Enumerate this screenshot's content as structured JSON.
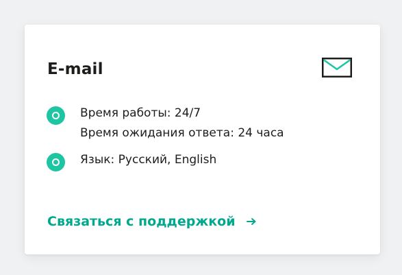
{
  "card": {
    "title": "E-mail",
    "icon": "mail-envelope-icon",
    "features": [
      {
        "lines": [
          "Время работы: 24/7",
          "Время ожидания ответа: 24 часа"
        ]
      },
      {
        "lines": [
          "Язык: Русский, English"
        ]
      }
    ],
    "cta_label": "Связаться с поддержкой",
    "cta_icon": "arrow-right-icon"
  },
  "colors": {
    "accent": "#1dc5a3",
    "link": "#00a88e",
    "text": "#1d1d1b",
    "page_background": "#eff1f2",
    "card_background": "#ffffff"
  }
}
